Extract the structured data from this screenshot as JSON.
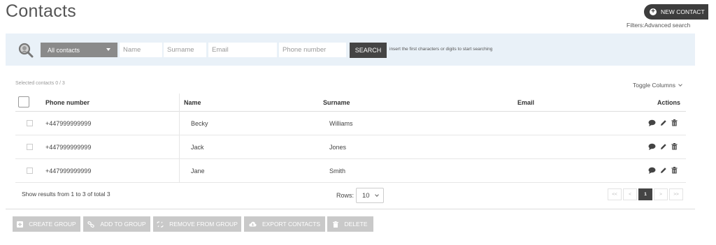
{
  "header": {
    "title": "Contacts",
    "new_contact_label": "NEW CONTACT",
    "filters_label": "Filters:Advanced search"
  },
  "search": {
    "select_value": "All contacts",
    "name_placeholder": "Name",
    "surname_placeholder": "Surname",
    "email_placeholder": "Email",
    "phone_placeholder": "Phone number",
    "button_label": "SEARCH",
    "hint": "insert the first characters or digits to start searching"
  },
  "table": {
    "selected_text": "Selected contacts 0 / 3",
    "toggle_columns": "Toggle Columns",
    "headers": {
      "phone": "Phone number",
      "name": "Name",
      "surname": "Surname",
      "email": "Email",
      "actions": "Actions"
    },
    "rows": [
      {
        "phone": "+447999999999",
        "name": "Becky",
        "surname": "Williams",
        "email": ""
      },
      {
        "phone": "+447999999999",
        "name": "Jack",
        "surname": "Jones",
        "email": ""
      },
      {
        "phone": "+447999999999",
        "name": "Jane",
        "surname": "Smith",
        "email": ""
      }
    ]
  },
  "pagination": {
    "results_text": "Show results from 1 to 3 of total 3",
    "rows_label": "Rows:",
    "rows_value": "10",
    "first": "<<",
    "prev": "<",
    "current": "1",
    "next": ">",
    "last": ">>"
  },
  "bulk_actions": {
    "create_group": "CREATE GROUP",
    "add_to_group": "ADD TO GROUP",
    "remove_from_group": "REMOVE FROM GROUP",
    "export_contacts": "EXPORT CONTACTS",
    "delete": "DELETE"
  },
  "colors": {
    "dark_button": "#444444",
    "disabled_button": "#c9c9c9",
    "search_panel": "#e9f1f8"
  }
}
